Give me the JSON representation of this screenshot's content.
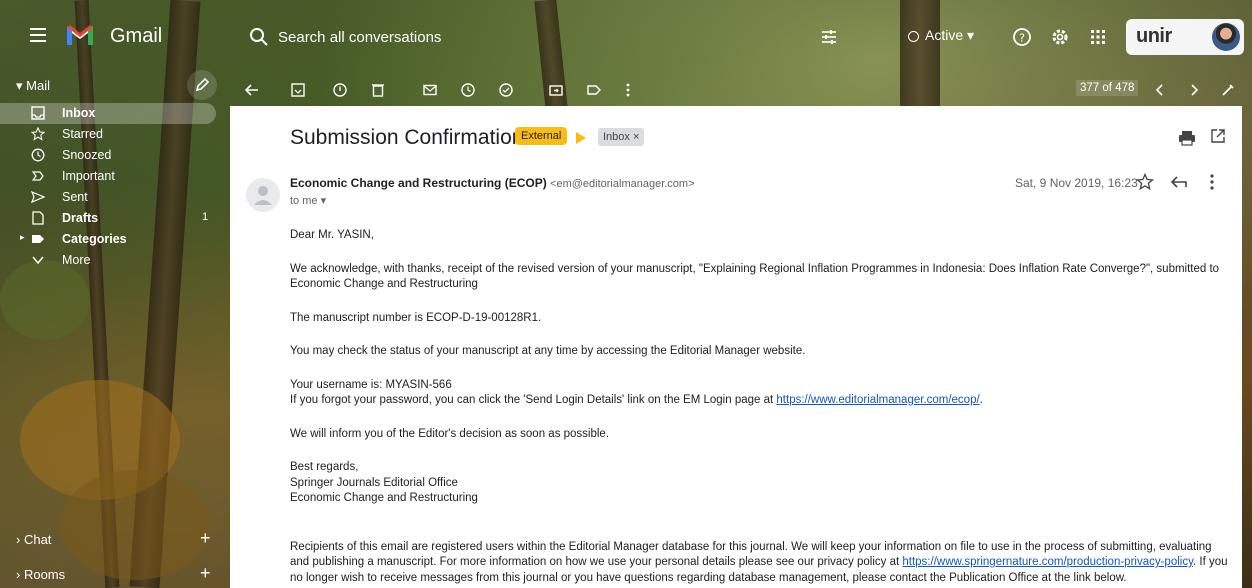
{
  "app": {
    "name": "Gmail",
    "logo_icon": "gmail-logo"
  },
  "search": {
    "placeholder": "Search all conversations"
  },
  "status": {
    "label": "Active"
  },
  "brand": {
    "logo_text": "unir"
  },
  "sidebar": {
    "mail_header": "Mail",
    "items": [
      {
        "label": "Inbox",
        "icon": "inbox-icon",
        "selected": true
      },
      {
        "label": "Starred",
        "icon": "star-icon"
      },
      {
        "label": "Snoozed",
        "icon": "clock-icon"
      },
      {
        "label": "Important",
        "icon": "important-icon"
      },
      {
        "label": "Sent",
        "icon": "send-icon"
      },
      {
        "label": "Drafts",
        "icon": "draft-icon",
        "count": "1"
      },
      {
        "label": "Categories",
        "icon": "label-icon"
      },
      {
        "label": "More",
        "icon": "chevron-down-icon"
      }
    ],
    "chat": "Chat",
    "rooms": "Rooms"
  },
  "toolbar": {
    "pager": "377 of 478"
  },
  "email": {
    "subject": "Submission Confirmation",
    "external_badge": "External",
    "inbox_chip": "Inbox ×",
    "sender_name": "Economic Change and Restructuring (ECOP)",
    "sender_email": "<em@editorialmanager.com>",
    "to": "to me ▾",
    "date": "Sat, 9 Nov 2019, 16:23",
    "greeting": "Dear Mr. YASIN,",
    "para1": "We acknowledge, with thanks, receipt of the revised version of your manuscript, \"Explaining Regional Inflation Programmes in Indonesia: Does Inflation Rate Converge?\", submitted to Economic Change and Restructuring",
    "para2": "The manuscript number is ECOP-D-19-00128R1.",
    "para3": "You may check the status of your manuscript at any time by accessing the Editorial Manager website.",
    "username": "Your username is: MYASIN-566",
    "forgot_prefix": "If you forgot your password, you can click the 'Send Login Details' link on the EM Login page at ",
    "login_link": "https://www.editorialmanager.com/ecop/",
    "forgot_suffix": ".",
    "para5": "We will inform you of the Editor's decision as soon as possible.",
    "sign1": "Best regards,",
    "sign2": "Springer Journals Editorial Office",
    "sign3": "Economic Change and Restructuring",
    "footer_prefix": "Recipients of this email are registered users within the Editorial Manager database for this journal. We will keep your information on file to use in the process of submitting, evaluating and publishing a manuscript. For more information on how we use your personal details please see our privacy policy at ",
    "privacy_link": "https://www.springernature.com/production-privacy-policy",
    "footer_suffix": ". If you no longer wish to receive messages from this journal or you have questions regarding database management, please contact the Publication Office at the link below."
  },
  "colors": {
    "external_badge": "#f9bc15",
    "link": "#1155cc"
  }
}
